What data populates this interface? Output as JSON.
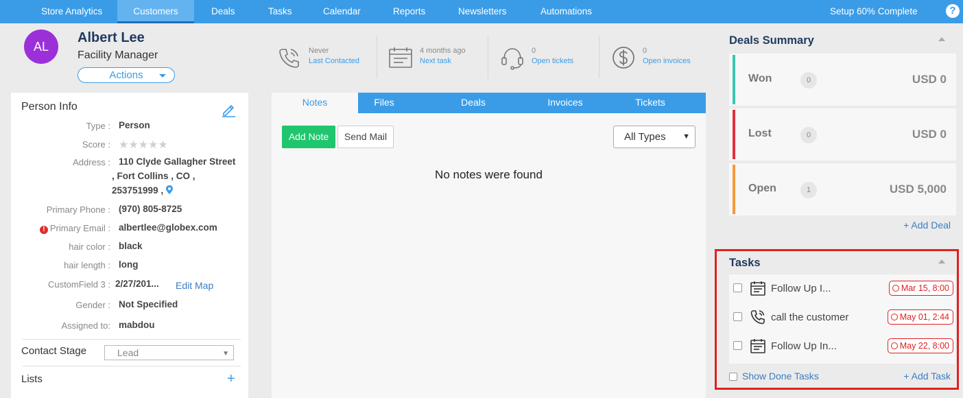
{
  "nav": {
    "items": [
      {
        "label": "Store Analytics"
      },
      {
        "label": "Customers",
        "active": true
      },
      {
        "label": "Deals"
      },
      {
        "label": "Tasks"
      },
      {
        "label": "Calendar"
      },
      {
        "label": "Reports"
      },
      {
        "label": "Newsletters"
      },
      {
        "label": "Automations"
      }
    ],
    "setup_status": "Setup 60% Complete",
    "help_label": "?"
  },
  "person": {
    "initials": "AL",
    "name": "Albert Lee",
    "title": "Facility Manager",
    "actions_label": "Actions"
  },
  "stats": [
    {
      "icon": "phone-icon",
      "line1": "Never",
      "line2": "Last Contacted"
    },
    {
      "icon": "calendar-icon",
      "line1": "4 months ago",
      "line2": "Next task"
    },
    {
      "icon": "headset-icon",
      "line1": "0",
      "line2": "Open tickets"
    },
    {
      "icon": "dollar-icon",
      "line1": "0",
      "line2": "Open invoices"
    }
  ],
  "person_info": {
    "section_title": "Person Info",
    "fields": {
      "type": {
        "label": "Type :",
        "value": "Person"
      },
      "score": {
        "label": "Score :",
        "stars": 0,
        "max_stars": 5
      },
      "address": {
        "label": "Address :",
        "line1": "110 Clyde Gallagher Street",
        "line2": ", Fort Collins , CO ,",
        "line3": "253751999 ,"
      },
      "primary_phone": {
        "label": "Primary Phone :",
        "value": "(970) 805-8725"
      },
      "primary_email": {
        "label": "Primary Email :",
        "value": "albertlee@globex.com"
      },
      "hair_color": {
        "label": "hair color :",
        "value": "black"
      },
      "hair_length": {
        "label": "hair length :",
        "value": "long"
      },
      "custom_field_3": {
        "label": "CustomField 3 :",
        "value": "2/27/201..."
      },
      "gender": {
        "label": "Gender :",
        "value": "Not Specified"
      },
      "assigned_to": {
        "label": "Assigned to:",
        "value": "mabdou"
      }
    },
    "edit_map_label": "Edit Map",
    "contact_stage_label": "Contact Stage",
    "contact_stage_value": "Lead",
    "lists_label": "Lists",
    "lists_add": "+"
  },
  "notes": {
    "tabs": [
      {
        "label": "Notes",
        "active": true
      },
      {
        "label": "Files"
      },
      {
        "label": "Deals"
      },
      {
        "label": "Invoices"
      },
      {
        "label": "Tickets"
      }
    ],
    "add_note_label": "Add Note",
    "send_mail_label": "Send Mail",
    "filter_value": "All Types",
    "empty_message": "No notes were found"
  },
  "deals_summary": {
    "title": "Deals Summary",
    "rows": [
      {
        "label": "Won",
        "count": "0",
        "amount": "USD 0",
        "color": "#3cc6b0"
      },
      {
        "label": "Lost",
        "count": "0",
        "amount": "USD 0",
        "color": "#e0303a"
      },
      {
        "label": "Open",
        "count": "1",
        "amount": "USD 5,000",
        "color": "#f39a3a"
      }
    ],
    "add_deal_label": "+ Add Deal"
  },
  "tasks": {
    "title": "Tasks",
    "items": [
      {
        "icon": "task-list-icon",
        "text": "Follow Up I...",
        "due": "Mar 15, 8:00"
      },
      {
        "icon": "phone-icon",
        "text": "call the customer",
        "due": "May 01, 2:44"
      },
      {
        "icon": "task-list-icon",
        "text": "Follow Up In...",
        "due": "May 22, 8:00"
      }
    ],
    "show_done_label": "Show Done Tasks",
    "add_task_label": "+ Add Task"
  }
}
